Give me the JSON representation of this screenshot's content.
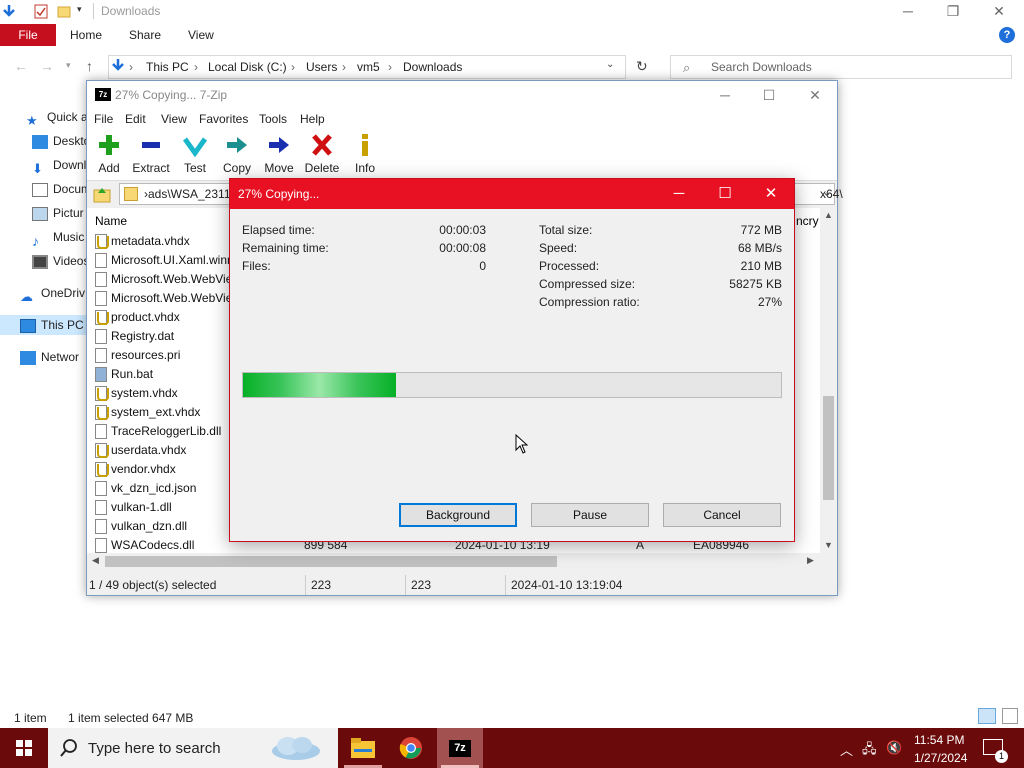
{
  "explorer": {
    "title": "Downloads",
    "ribbon": {
      "file": "File",
      "home": "Home",
      "share": "Share",
      "view": "View"
    },
    "breadcrumb": [
      "This PC",
      "Local Disk (C:)",
      "Users",
      "vm5",
      "Downloads"
    ],
    "search_placeholder": "Search Downloads",
    "nav": [
      "Quick a",
      "Deskto",
      "Downl",
      "Docum",
      "Pictur",
      "Music",
      "Videos",
      "OneDriv",
      "This PC",
      "Networ"
    ],
    "status": {
      "count": "1 item",
      "selected": "1 item selected  647 MB"
    }
  },
  "sevenzip": {
    "title": "27% Copying... 7-Zip",
    "menu": [
      "File",
      "Edit",
      "View",
      "Favorites",
      "Tools",
      "Help"
    ],
    "toolbar": [
      "Add",
      "Extract",
      "Test",
      "Copy",
      "Move",
      "Delete",
      "Info"
    ],
    "path_left": "›ads\\WSA_2311.4",
    "path_right": "x64\\",
    "column_name": "Name",
    "column_right": "ncry",
    "files": [
      "metadata.vhdx",
      "Microsoft.UI.Xaml.winm",
      "Microsoft.Web.WebView",
      "Microsoft.Web.WebView",
      "product.vhdx",
      "Registry.dat",
      "resources.pri",
      "Run.bat",
      "system.vhdx",
      "system_ext.vhdx",
      "TraceReloggerLib.dll",
      "userdata.vhdx",
      "vendor.vhdx",
      "vk_dzn_icd.json",
      "vulkan-1.dll",
      "vulkan_dzn.dll",
      "WSACodecs.dll"
    ],
    "last_row": {
      "size": "899 584",
      "modified": "2024-01-10 13:19",
      "attr": "A",
      "crc": "EA089946"
    },
    "status": {
      "selected": "1 / 49 object(s) selected",
      "size1": "223",
      "size2": "223",
      "modified": "2024-01-10 13:19:04"
    }
  },
  "dialog": {
    "title": "27% Copying...",
    "elapsed_label": "Elapsed time:",
    "elapsed": "00:00:03",
    "remaining_label": "Remaining time:",
    "remaining": "00:00:08",
    "files_label": "Files:",
    "files": "0",
    "total_label": "Total size:",
    "total": "772 MB",
    "speed_label": "Speed:",
    "speed": "68 MB/s",
    "processed_label": "Processed:",
    "processed": "210 MB",
    "compressed_label": "Compressed size:",
    "compressed": "58275 KB",
    "ratio_label": "Compression ratio:",
    "ratio": "27%",
    "progress": 0.285,
    "buttons": {
      "background": "Background",
      "pause": "Pause",
      "cancel": "Cancel"
    }
  },
  "taskbar": {
    "search_placeholder": "Type here to search",
    "time": "11:54 PM",
    "date": "1/27/2024",
    "notification_count": "1"
  },
  "colors": {
    "accent_red": "#e81123",
    "taskbar": "#6b0a0a",
    "progress_green": "#06b025"
  }
}
